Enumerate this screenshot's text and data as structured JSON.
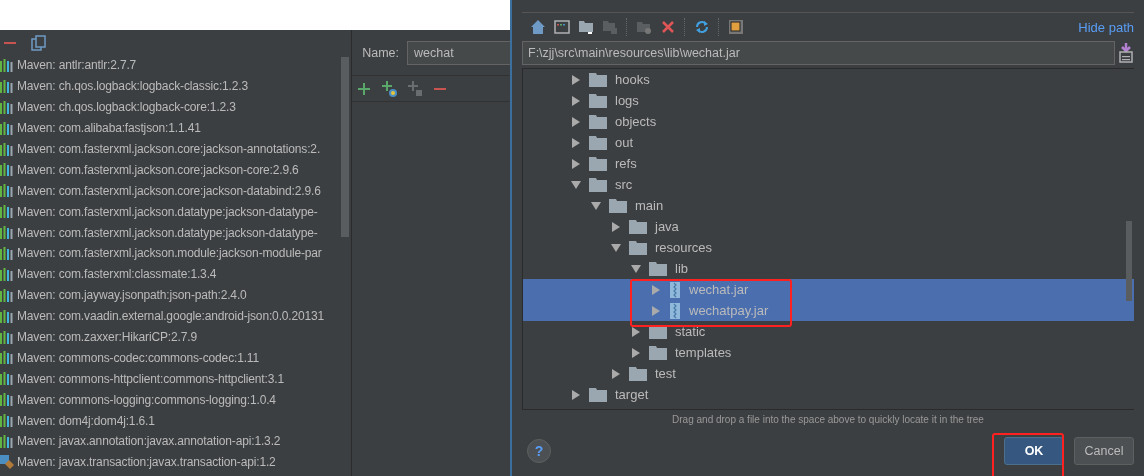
{
  "libraries_panel": {
    "items": [
      {
        "label": "Maven: antlr:antlr:2.7.7",
        "kind": "maven"
      },
      {
        "label": "Maven: ch.qos.logback:logback-classic:1.2.3",
        "kind": "maven"
      },
      {
        "label": "Maven: ch.qos.logback:logback-core:1.2.3",
        "kind": "maven"
      },
      {
        "label": "Maven: com.alibaba:fastjson:1.1.41",
        "kind": "maven"
      },
      {
        "label": "Maven: com.fasterxml.jackson.core:jackson-annotations:2.",
        "kind": "maven"
      },
      {
        "label": "Maven: com.fasterxml.jackson.core:jackson-core:2.9.6",
        "kind": "maven"
      },
      {
        "label": "Maven: com.fasterxml.jackson.core:jackson-databind:2.9.6",
        "kind": "maven"
      },
      {
        "label": "Maven: com.fasterxml.jackson.datatype:jackson-datatype-",
        "kind": "maven"
      },
      {
        "label": "Maven: com.fasterxml.jackson.datatype:jackson-datatype-",
        "kind": "maven"
      },
      {
        "label": "Maven: com.fasterxml.jackson.module:jackson-module-par",
        "kind": "maven"
      },
      {
        "label": "Maven: com.fasterxml:classmate:1.3.4",
        "kind": "maven"
      },
      {
        "label": "Maven: com.jayway.jsonpath:json-path:2.4.0",
        "kind": "maven"
      },
      {
        "label": "Maven: com.vaadin.external.google:android-json:0.0.20131",
        "kind": "maven"
      },
      {
        "label": "Maven: com.zaxxer:HikariCP:2.7.9",
        "kind": "maven"
      },
      {
        "label": "Maven: commons-codec:commons-codec:1.11",
        "kind": "maven"
      },
      {
        "label": "Maven: commons-httpclient:commons-httpclient:3.1",
        "kind": "maven"
      },
      {
        "label": "Maven: commons-logging:commons-logging:1.0.4",
        "kind": "maven"
      },
      {
        "label": "Maven: dom4j:dom4j:1.6.1",
        "kind": "maven"
      },
      {
        "label": "Maven: javax.annotation:javax.annotation-api:1.3.2",
        "kind": "maven"
      },
      {
        "label": "Maven: javax.transaction:javax.transaction-api:1.2",
        "kind": "jar"
      }
    ]
  },
  "library_editor": {
    "name_label": "Name:",
    "name_value": "wechat"
  },
  "file_chooser": {
    "hide_path": "Hide path",
    "path": "F:\\zjj\\src\\main\\resources\\lib\\wechat.jar",
    "tree": [
      {
        "label": "hooks",
        "kind": "folder",
        "expanded": false,
        "selected": false
      },
      {
        "label": "logs",
        "kind": "folder",
        "expanded": false,
        "selected": false
      },
      {
        "label": "objects",
        "kind": "folder",
        "expanded": false,
        "selected": false
      },
      {
        "label": "out",
        "kind": "folder",
        "expanded": false,
        "selected": false
      },
      {
        "label": "refs",
        "kind": "folder",
        "expanded": false,
        "selected": false
      },
      {
        "label": "src",
        "kind": "folder",
        "expanded": true,
        "selected": false,
        "children": [
          {
            "label": "main",
            "kind": "folder",
            "expanded": true,
            "selected": false,
            "children": [
              {
                "label": "java",
                "kind": "folder",
                "expanded": false,
                "selected": false
              },
              {
                "label": "resources",
                "kind": "folder",
                "expanded": true,
                "selected": false,
                "children": [
                  {
                    "label": "lib",
                    "kind": "folder",
                    "expanded": true,
                    "selected": false,
                    "children": [
                      {
                        "label": "wechat.jar",
                        "kind": "jar",
                        "expanded": false,
                        "selected": true
                      },
                      {
                        "label": "wechatpay.jar",
                        "kind": "jar",
                        "expanded": false,
                        "selected": true
                      }
                    ]
                  },
                  {
                    "label": "static",
                    "kind": "folder",
                    "expanded": false,
                    "selected": false
                  },
                  {
                    "label": "templates",
                    "kind": "folder",
                    "expanded": false,
                    "selected": false
                  }
                ]
              },
              {
                "label": "test",
                "kind": "folder",
                "expanded": false,
                "selected": false
              }
            ]
          }
        ]
      },
      {
        "label": "target",
        "kind": "folder",
        "expanded": false,
        "selected": false
      }
    ],
    "hint": "Drag and drop a file into the space above to quickly locate it in the tree",
    "help": "?",
    "buttons": [
      {
        "label": "OK",
        "default": true
      },
      {
        "label": "Cancel",
        "default": false
      }
    ]
  }
}
